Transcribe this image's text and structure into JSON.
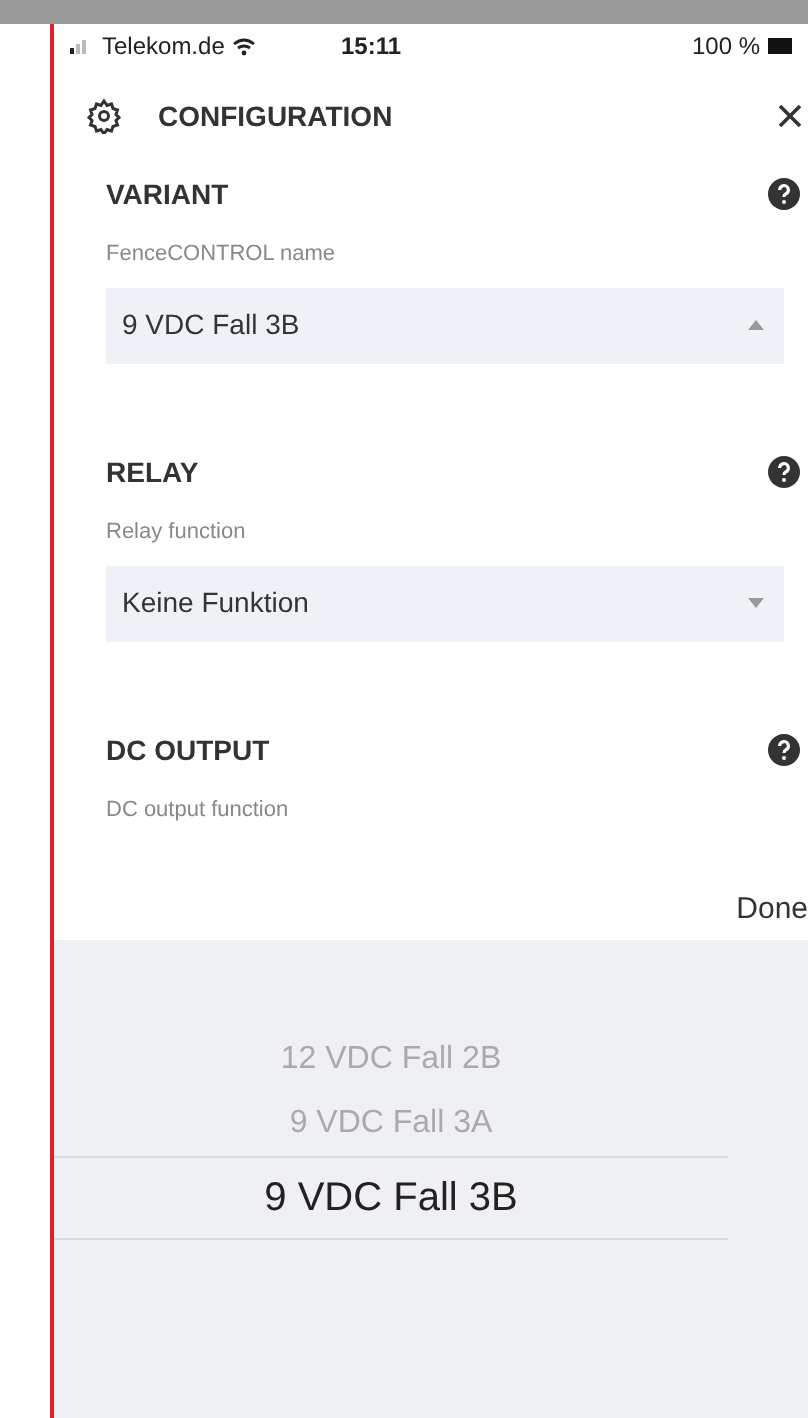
{
  "status_bar": {
    "carrier": "Telekom.de",
    "time": "15:11",
    "battery": "100 %"
  },
  "header": {
    "title": "CONFIGURATION"
  },
  "sections": [
    {
      "title": "VARIANT",
      "field_label": "FenceCONTROL name",
      "value": "9 VDC Fall 3B",
      "expanded": true
    },
    {
      "title": "RELAY",
      "field_label": "Relay function",
      "value": "Keine Funktion",
      "expanded": false
    },
    {
      "title": "DC OUTPUT",
      "field_label": "DC output function"
    }
  ],
  "picker": {
    "done": "Done",
    "items": [
      {
        "label": "12 VDC Fall 2B",
        "selected": false
      },
      {
        "label": "9 VDC Fall 3A",
        "selected": false
      },
      {
        "label": "9 VDC Fall 3B",
        "selected": true
      }
    ]
  }
}
